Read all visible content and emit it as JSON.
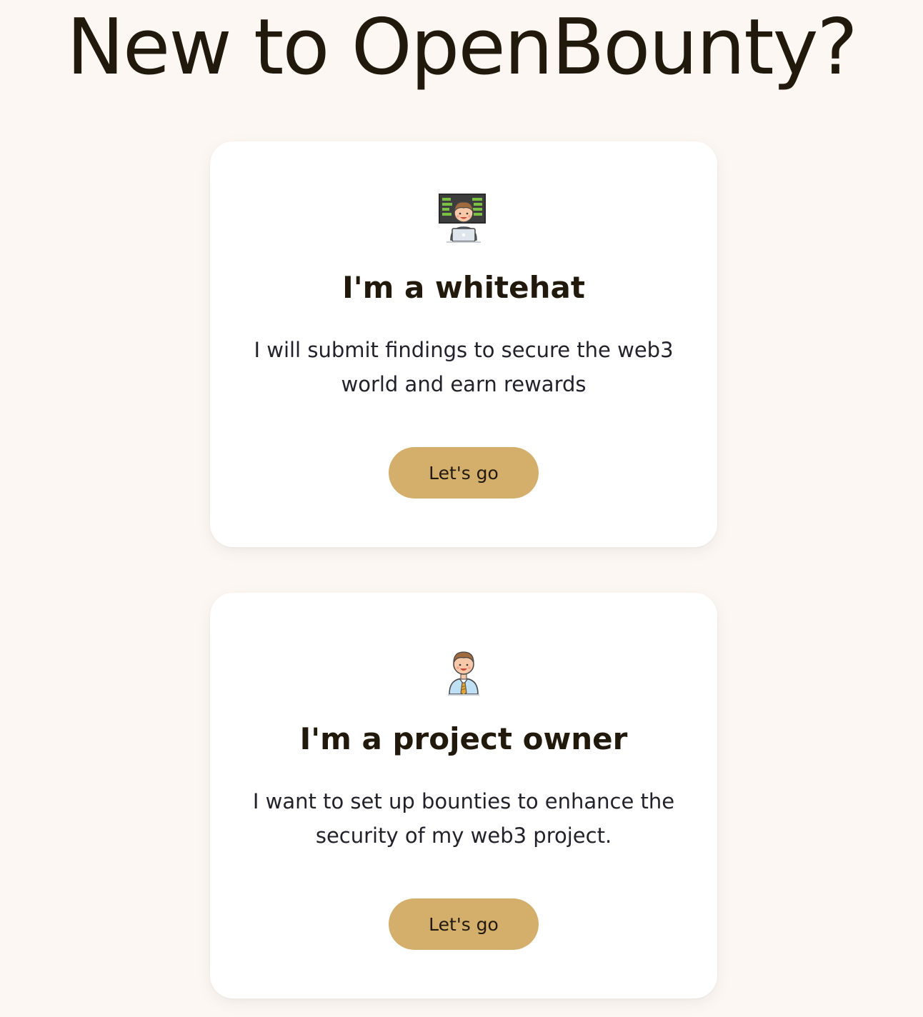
{
  "header": {
    "title": "New to OpenBounty?"
  },
  "cards": [
    {
      "icon": "whitehat-hacker-icon",
      "title": "I'm a whitehat",
      "description": "I will submit findings to secure the web3 world and earn rewards",
      "button_label": "Let's go"
    },
    {
      "icon": "project-owner-icon",
      "title": "I'm a project owner",
      "description": "I want to set up bounties to enhance the security of my web3 project.",
      "button_label": "Let's go"
    }
  ],
  "colors": {
    "background": "#fcf7f3",
    "card": "#ffffff",
    "accent_button": "#d3af6b",
    "heading_text": "#21190b"
  }
}
